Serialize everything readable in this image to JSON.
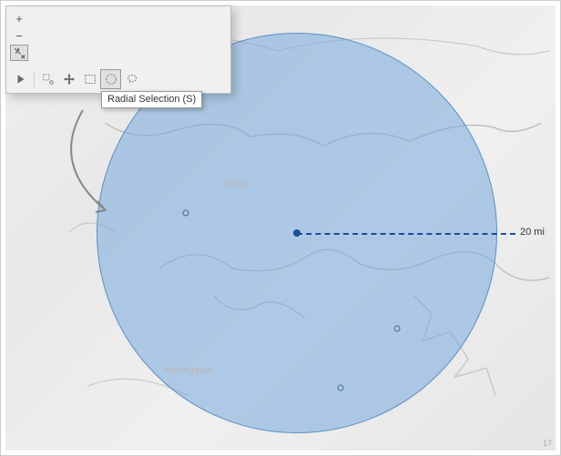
{
  "toolbar": {
    "zoom_in": "+",
    "zoom_out": "−",
    "pin_icon": "pin",
    "play_icon": "play",
    "point_select": "point-select",
    "pan": "pan",
    "rect_select": "rectangular-selection",
    "radial_select": "radial-selection",
    "lasso_select": "lasso-selection"
  },
  "tooltip": {
    "text": "Radial Selection (S)"
  },
  "map": {
    "region_labels": {
      "tokyo": "Tokyo",
      "kanagawa": "Kanagawa"
    },
    "radius_label": "20 mi",
    "attribution": "17"
  }
}
